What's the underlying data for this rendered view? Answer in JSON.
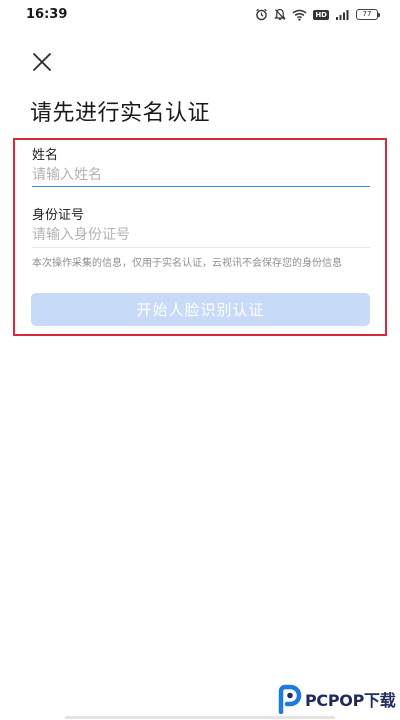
{
  "status_bar": {
    "time": "16:39",
    "hd_label": "HD",
    "battery_level": "77"
  },
  "page": {
    "title": "请先进行实名认证"
  },
  "form": {
    "name_label": "姓名",
    "name_placeholder": "请输入姓名",
    "name_value": "",
    "id_label": "身份证号",
    "id_placeholder": "请输入身份证号",
    "id_value": "",
    "note": "本次操作采集的信息，仅用于实名认证，云视讯不会保存您的身份信息",
    "submit_label": "开始人脸识别认证",
    "submit_enabled": false
  },
  "watermark": {
    "text": "PCPOP下载"
  },
  "colors": {
    "highlight_border": "#d8283c",
    "button_disabled_bg": "#c7daf7",
    "active_underline": "#2e8fe6",
    "inactive_underline": "#e6e6e6",
    "placeholder": "#b4b4b4",
    "watermark_blue": "#1f7ae0"
  },
  "icons": {
    "close": "close-icon",
    "alarm": "alarm-icon",
    "mute": "mute-icon",
    "wifi": "wifi-icon",
    "signal": "signal-icon",
    "battery": "battery-icon",
    "watermark_logo": "pcpop-logo-icon"
  }
}
